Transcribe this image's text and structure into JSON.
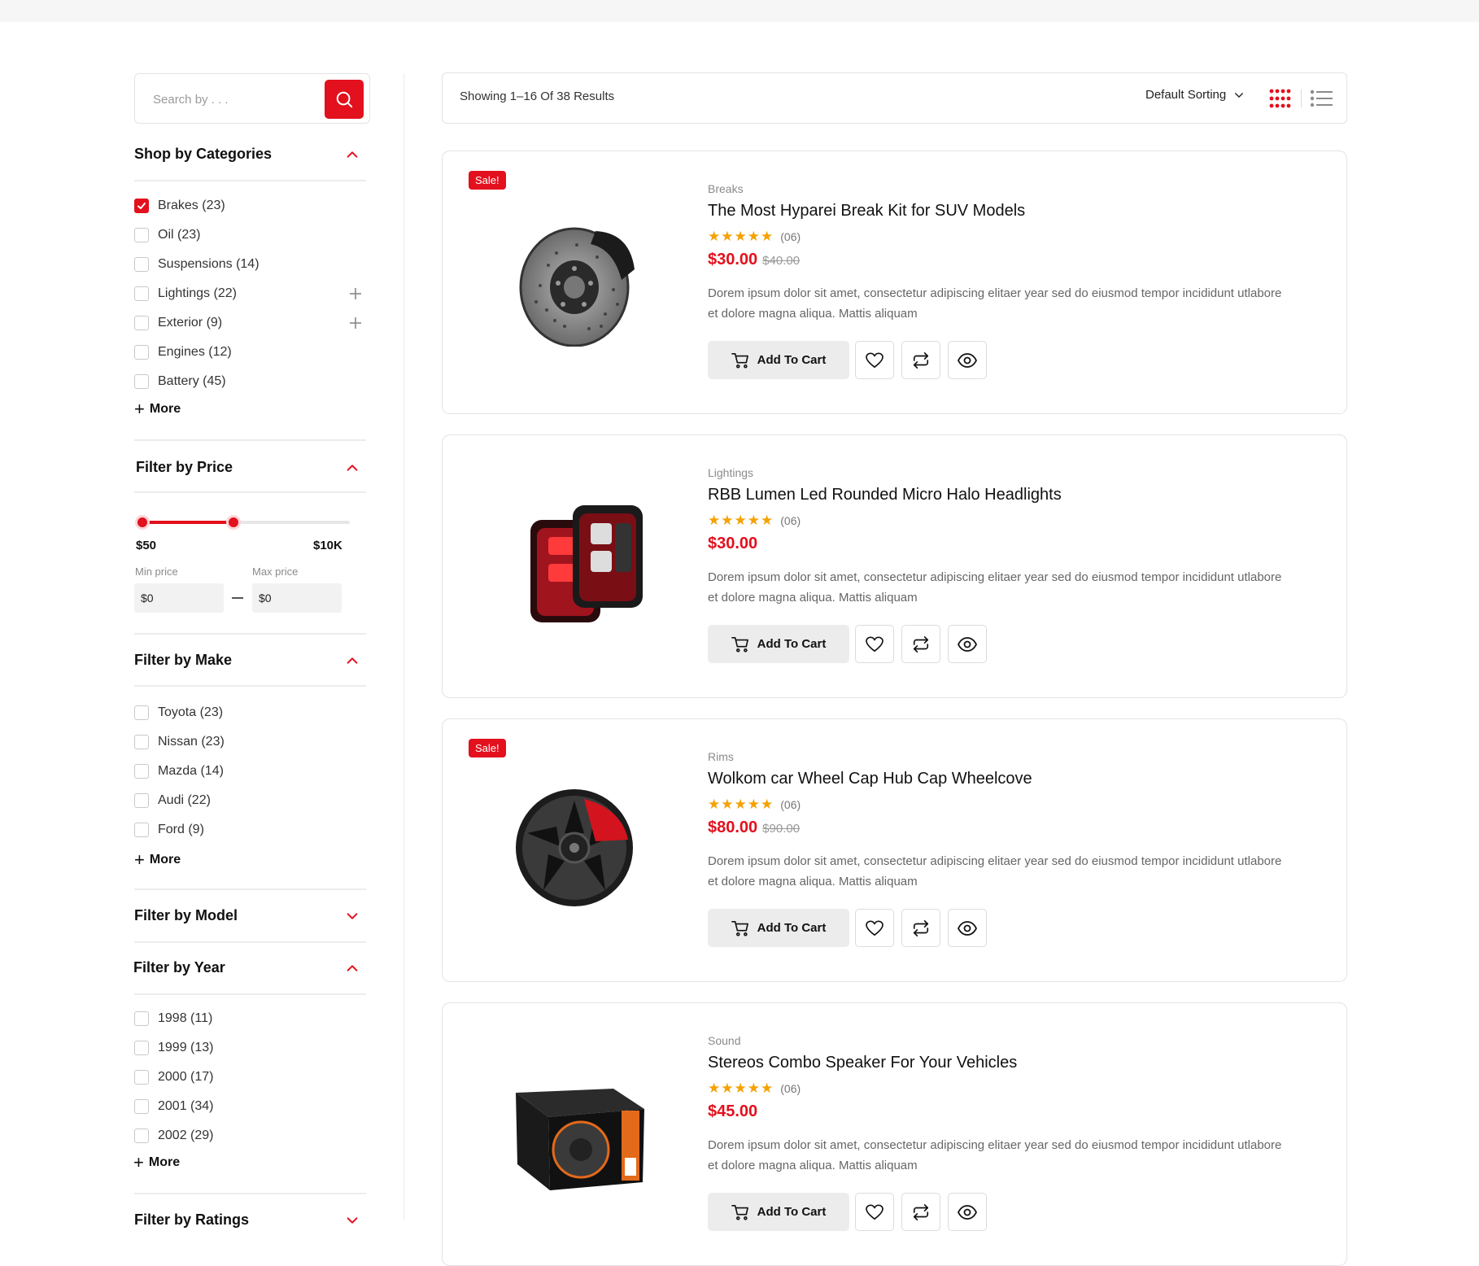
{
  "search": {
    "placeholder": "Search by . . ."
  },
  "categories": {
    "title": "Shop by Categories",
    "items": [
      {
        "label": "Brakes (23)",
        "checked": true
      },
      {
        "label": "Oil (23)"
      },
      {
        "label": "Suspensions (14)"
      },
      {
        "label": "Lightings (22)"
      },
      {
        "label": "Exterior (9)"
      },
      {
        "label": "Engines (12)"
      },
      {
        "label": "Battery (45)"
      }
    ],
    "more": "More"
  },
  "price": {
    "title": "Filter by Price",
    "range_min_label": "$50",
    "range_max_label": "$10K",
    "range_low_fraction": 0.0,
    "range_high_fraction": 0.44,
    "min_caption": "Min price",
    "max_caption": "Max price",
    "min_value": "$0",
    "max_value": "$0"
  },
  "make": {
    "title": "Filter by Make",
    "items": [
      {
        "label": "Toyota (23)"
      },
      {
        "label": "Nissan (23)"
      },
      {
        "label": "Mazda (14)"
      },
      {
        "label": "Audi (22)"
      },
      {
        "label": "Ford (9)"
      }
    ],
    "more": "More"
  },
  "model": {
    "title": "Filter by Model"
  },
  "year": {
    "title": "Filter by Year",
    "items": [
      {
        "label": "1998 (11)"
      },
      {
        "label": "1999 (13)"
      },
      {
        "label": "2000 (17)"
      },
      {
        "label": "2001 (34)"
      },
      {
        "label": "2002 (29)"
      }
    ],
    "more": "More"
  },
  "ratings": {
    "title": "Filter by Ratings"
  },
  "toolbar": {
    "result_text": "Showing 1–16 Of 38 Results",
    "sorting": "Default Sorting"
  },
  "colors": {
    "accent": "#e3101d",
    "star": "#f5a100"
  },
  "products": [
    {
      "sale": "Sale!",
      "category": "Breaks",
      "title": "The Most Hyparei Break Kit for SUV Models",
      "rating_count": "(06)",
      "price": "$30.00",
      "old_price": "$40.00",
      "description": "Dorem ipsum dolor sit amet, consectetur adipiscing elitaer year sed do eiusmod tempor incididunt utlabore et dolore magna aliqua. Mattis aliquam",
      "cart_label": "Add To Cart"
    },
    {
      "sale": "",
      "category": "Lightings",
      "title": "RBB Lumen Led Rounded  Micro  Halo Headlights",
      "rating_count": "(06)",
      "price": "$30.00",
      "old_price": "",
      "description": "Dorem ipsum dolor sit amet, consectetur adipiscing elitaer year sed do eiusmod tempor incididunt utlabore et dolore magna aliqua. Mattis aliquam",
      "cart_label": "Add To Cart"
    },
    {
      "sale": "Sale!",
      "category": "Rims",
      "title": "Wolkom car Wheel Cap Hub  Cap Wheelcove",
      "rating_count": "(06)",
      "price": "$80.00",
      "old_price": "$90.00",
      "description": "Dorem ipsum dolor sit amet, consectetur adipiscing elitaer year sed do eiusmod tempor incididunt utlabore et dolore magna aliqua. Mattis aliquam",
      "cart_label": "Add To Cart"
    },
    {
      "sale": "",
      "category": "Sound",
      "title": "Stereos Combo Speaker For  Your Vehicles",
      "rating_count": "(06)",
      "price": "$45.00",
      "old_price": "",
      "description": "Dorem ipsum dolor sit amet, consectetur adipiscing elitaer year sed do eiusmod tempor incididunt utlabore et dolore magna aliqua. Mattis aliquam",
      "cart_label": "Add To Cart"
    }
  ]
}
